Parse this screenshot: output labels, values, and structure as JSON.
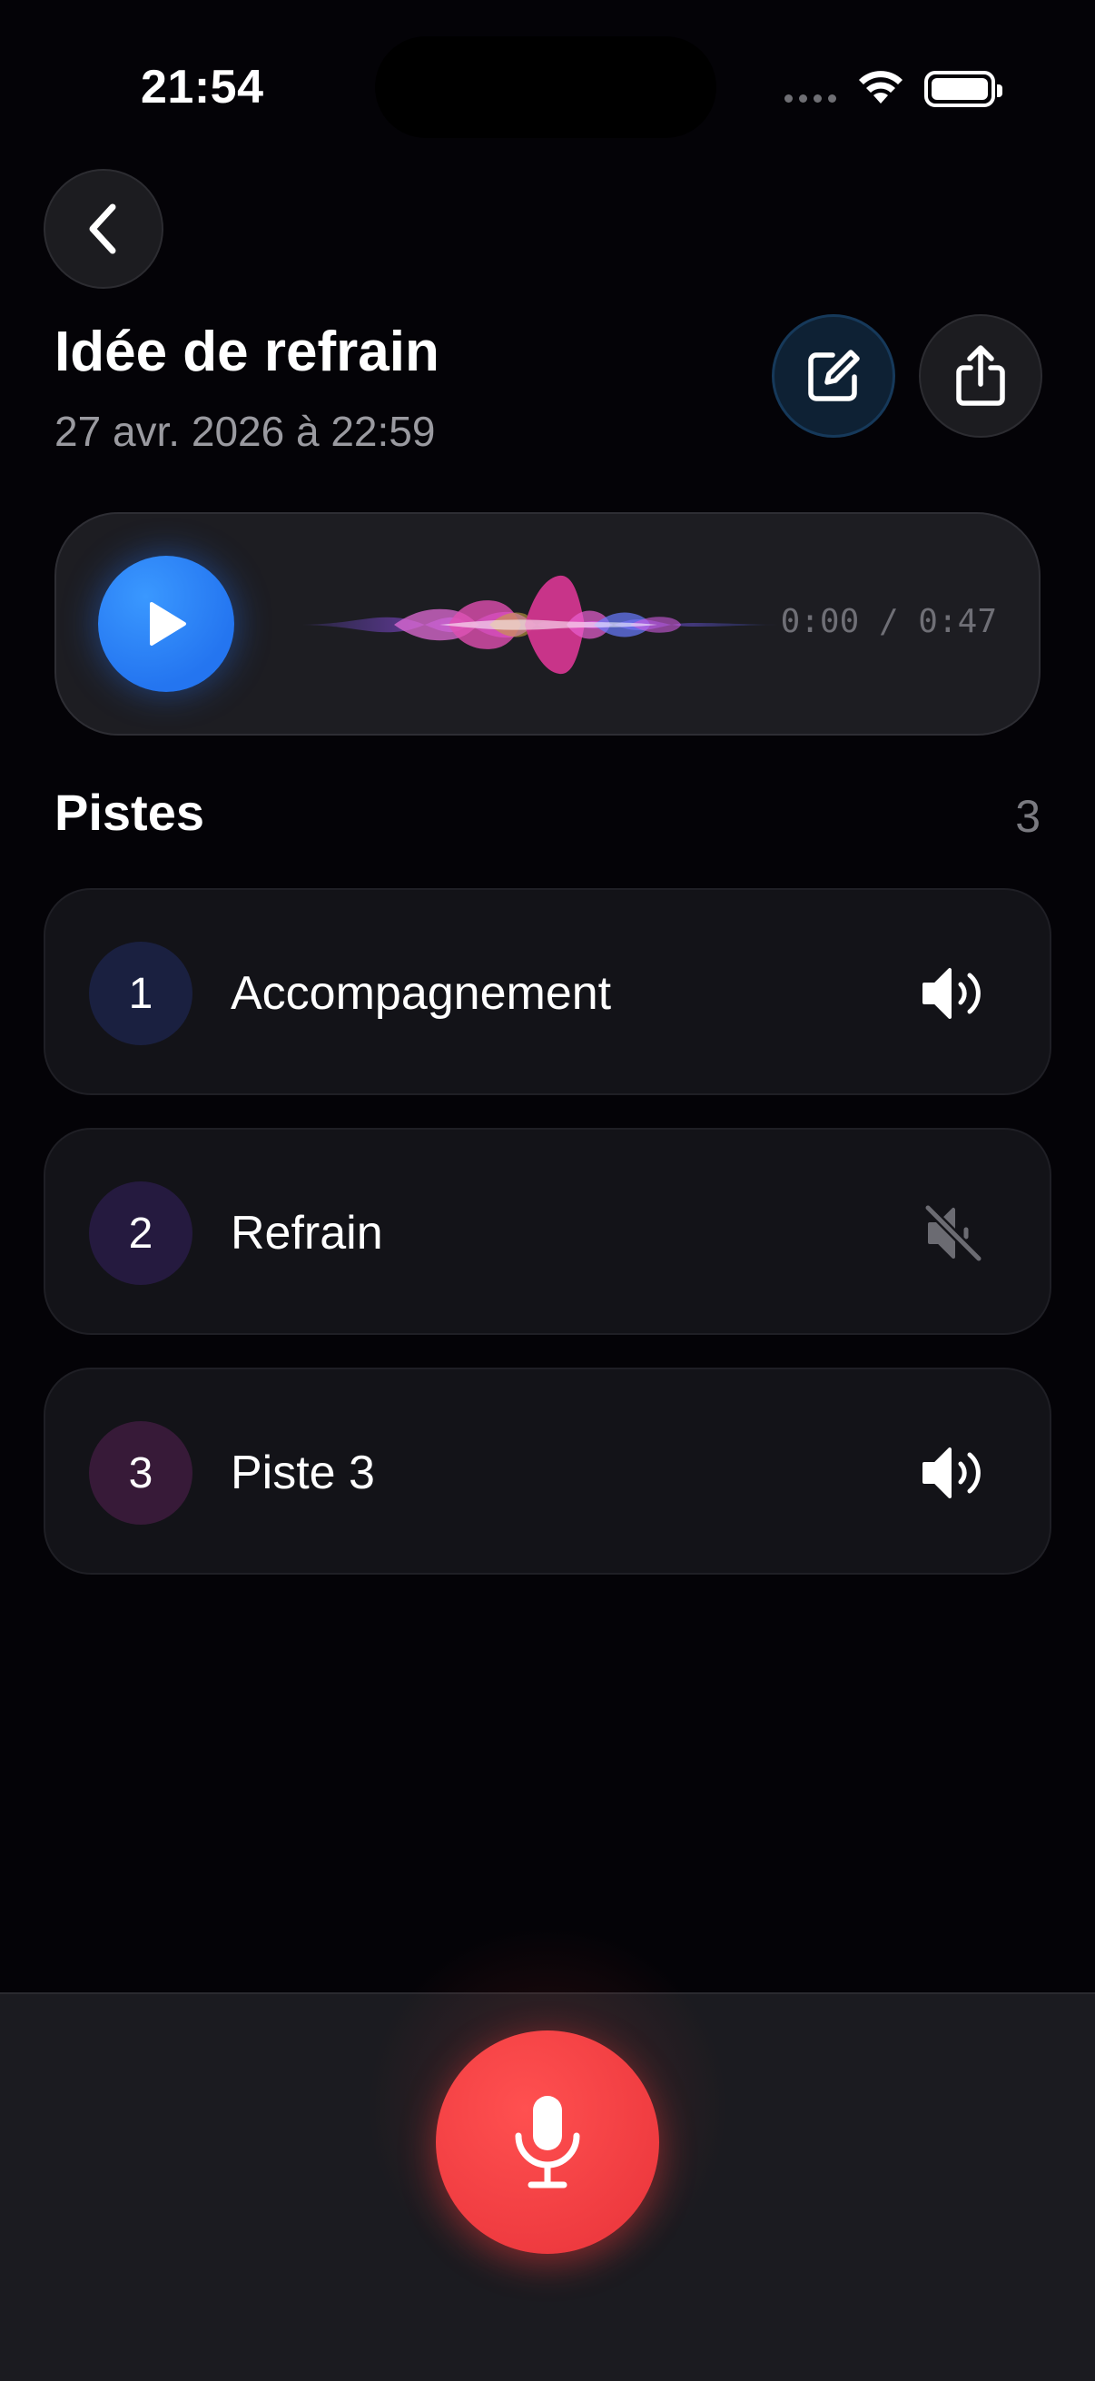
{
  "status_bar": {
    "time": "21:54"
  },
  "header": {
    "title": "Idée de refrain",
    "date": "27 avr. 2026 à 22:59"
  },
  "player": {
    "time_display": "0:00 / 0:47",
    "progress": 0
  },
  "tracks_section": {
    "title": "Pistes",
    "count": "3"
  },
  "tracks": [
    {
      "number": "1",
      "name": "Accompagnement",
      "muted": false,
      "accent": "#1a2040"
    },
    {
      "number": "2",
      "name": "Refrain",
      "muted": true,
      "accent": "#251a3f"
    },
    {
      "number": "3",
      "name": "Piste 3",
      "muted": false,
      "accent": "#371a38"
    }
  ],
  "colors": {
    "play_accent": "#2f86ff",
    "record_accent": "#f2454a",
    "edit_accent": "#16395a"
  },
  "icons": {
    "back": "chevron-left-icon",
    "edit": "edit-icon",
    "share": "share-icon",
    "play": "play-icon",
    "record": "microphone-icon",
    "volume_on": "speaker-icon",
    "volume_off": "speaker-muted-icon"
  }
}
